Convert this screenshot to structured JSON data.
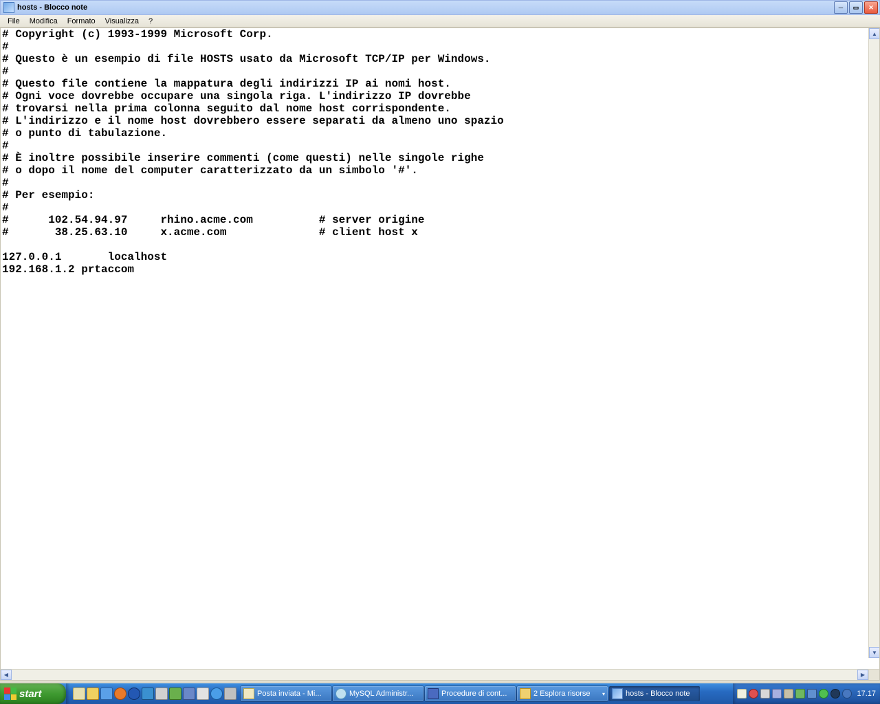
{
  "window": {
    "title": "hosts - Blocco note"
  },
  "menu": {
    "file": "File",
    "modifica": "Modifica",
    "formato": "Formato",
    "visualizza": "Visualizza",
    "help": "?"
  },
  "editor": {
    "content": "# Copyright (c) 1993-1999 Microsoft Corp.\n#\n# Questo è un esempio di file HOSTS usato da Microsoft TCP/IP per Windows.\n#\n# Questo file contiene la mappatura degli indirizzi IP ai nomi host.\n# Ogni voce dovrebbe occupare una singola riga. L'indirizzo IP dovrebbe\n# trovarsi nella prima colonna seguito dal nome host corrispondente.\n# L'indirizzo e il nome host dovrebbero essere separati da almeno uno spazio\n# o punto di tabulazione.\n#\n# È inoltre possibile inserire commenti (come questi) nelle singole righe\n# o dopo il nome del computer caratterizzato da un simbolo '#'.\n#\n# Per esempio:\n#\n#      102.54.94.97     rhino.acme.com          # server origine\n#       38.25.63.10     x.acme.com              # client host x\n\n127.0.0.1       localhost\n192.168.1.2 prtaccom"
  },
  "taskbar": {
    "start": "start",
    "buttons": [
      {
        "label": "Posta inviata - Mi..."
      },
      {
        "label": "MySQL Administr..."
      },
      {
        "label": "Procedure di cont..."
      },
      {
        "label": "2 Esplora risorse",
        "grouped": true
      },
      {
        "label": "hosts - Blocco note",
        "active": true
      }
    ],
    "clock": "17.17"
  }
}
